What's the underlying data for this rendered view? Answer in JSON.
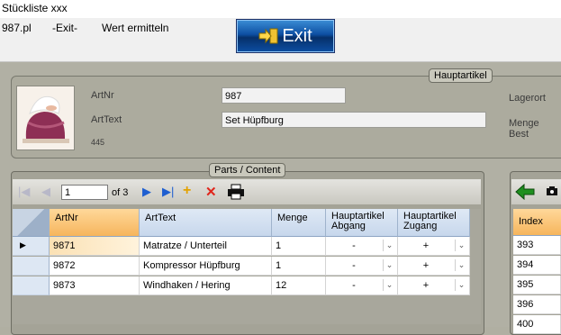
{
  "window": {
    "title": "Stückliste xxx"
  },
  "menu": {
    "item1": "987.pl",
    "item2": "-Exit-",
    "item3": "Wert ermitteln",
    "exit_button": "Exit"
  },
  "haupt": {
    "title": "Hauptartikel",
    "artnr_label": "ArtNr",
    "artnr_value": "987",
    "arttext_label": "ArtText",
    "arttext_value": "Set Hüpfburg",
    "small_number": "445",
    "lagerort_label": "Lagerort",
    "menge_label": "Menge Best"
  },
  "parts": {
    "title": "Parts / Content",
    "page_value": "1",
    "page_of": "of 3",
    "columns": [
      "ArtNr",
      "ArtText",
      "Menge",
      "Hauptartikel Abgang",
      "Hauptartikel Zugang"
    ],
    "rows": [
      {
        "artnr": "9871",
        "arttext": "Matratze / Unterteil",
        "menge": "1",
        "abgang": "-",
        "zugang": "+"
      },
      {
        "artnr": "9872",
        "arttext": "Kompressor Hüpfburg",
        "menge": "1",
        "abgang": "-",
        "zugang": "+"
      },
      {
        "artnr": "9873",
        "arttext": "Windhaken / Hering",
        "menge": "12",
        "abgang": "-",
        "zugang": "+"
      }
    ]
  },
  "right": {
    "column": "Index",
    "rows": [
      "393",
      "394",
      "395",
      "396",
      "400"
    ]
  },
  "colors": {
    "accent_blue": "#0d4fa3",
    "selected_header": "#f6b55c",
    "green_arrow": "#1f8f1f",
    "delete_red": "#e0261c"
  }
}
